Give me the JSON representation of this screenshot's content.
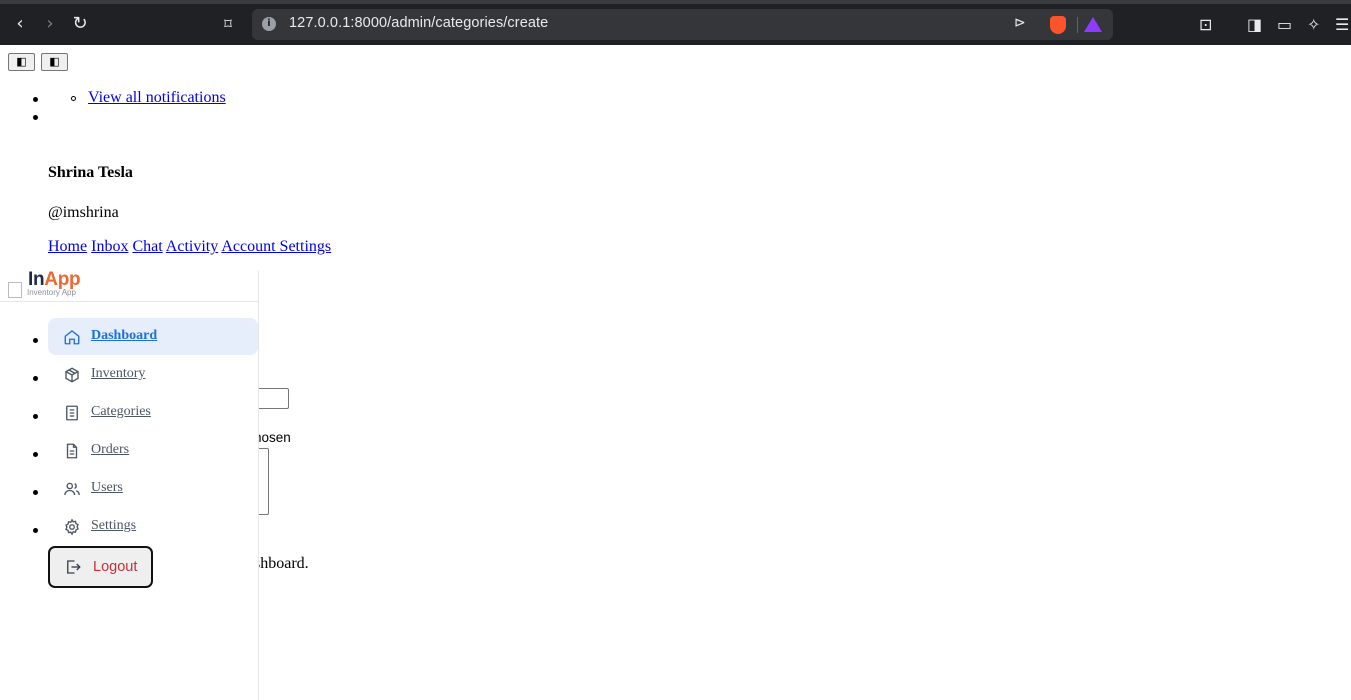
{
  "browser": {
    "url": "127.0.0.1:8000/admin/categories/create",
    "back_icon": "chevron-left-icon",
    "forward_icon": "chevron-right-icon",
    "reload_icon": "reload-icon",
    "bookmark_icon": "bookmark-icon"
  },
  "topbar": {
    "toggle_left_icon": "sidebar-toggle-icon",
    "toggle_right_icon": "sidebar-toggle-icon"
  },
  "notifications": {
    "view_all_label": "View all notifications"
  },
  "user": {
    "name": "Shrina Tesla",
    "handle": "@imshrina",
    "menu": [
      "Home",
      "Inbox",
      "Chat",
      "Activity",
      "Account Settings"
    ]
  },
  "sidebar": {
    "logo_alt": "Inventory App",
    "logo_in": "In",
    "logo_app": "App",
    "accent_color": "#1d6fe0",
    "items": [
      {
        "label": "Dashboard",
        "icon": "home-icon",
        "active": true
      },
      {
        "label": "Inventory",
        "icon": "box-icon",
        "active": false
      },
      {
        "label": "Categories",
        "icon": "clipboard-list-icon",
        "active": false
      },
      {
        "label": "Orders",
        "icon": "document-icon",
        "active": false
      },
      {
        "label": "Users",
        "icon": "users-icon",
        "active": false
      },
      {
        "label": "Settings",
        "icon": "gear-icon",
        "active": false
      }
    ],
    "logout_label": "Logout",
    "logout_color": "#c5303a"
  },
  "form_fragments": {
    "file_status_tail": "nosen",
    "footer_tail": "shboard."
  }
}
